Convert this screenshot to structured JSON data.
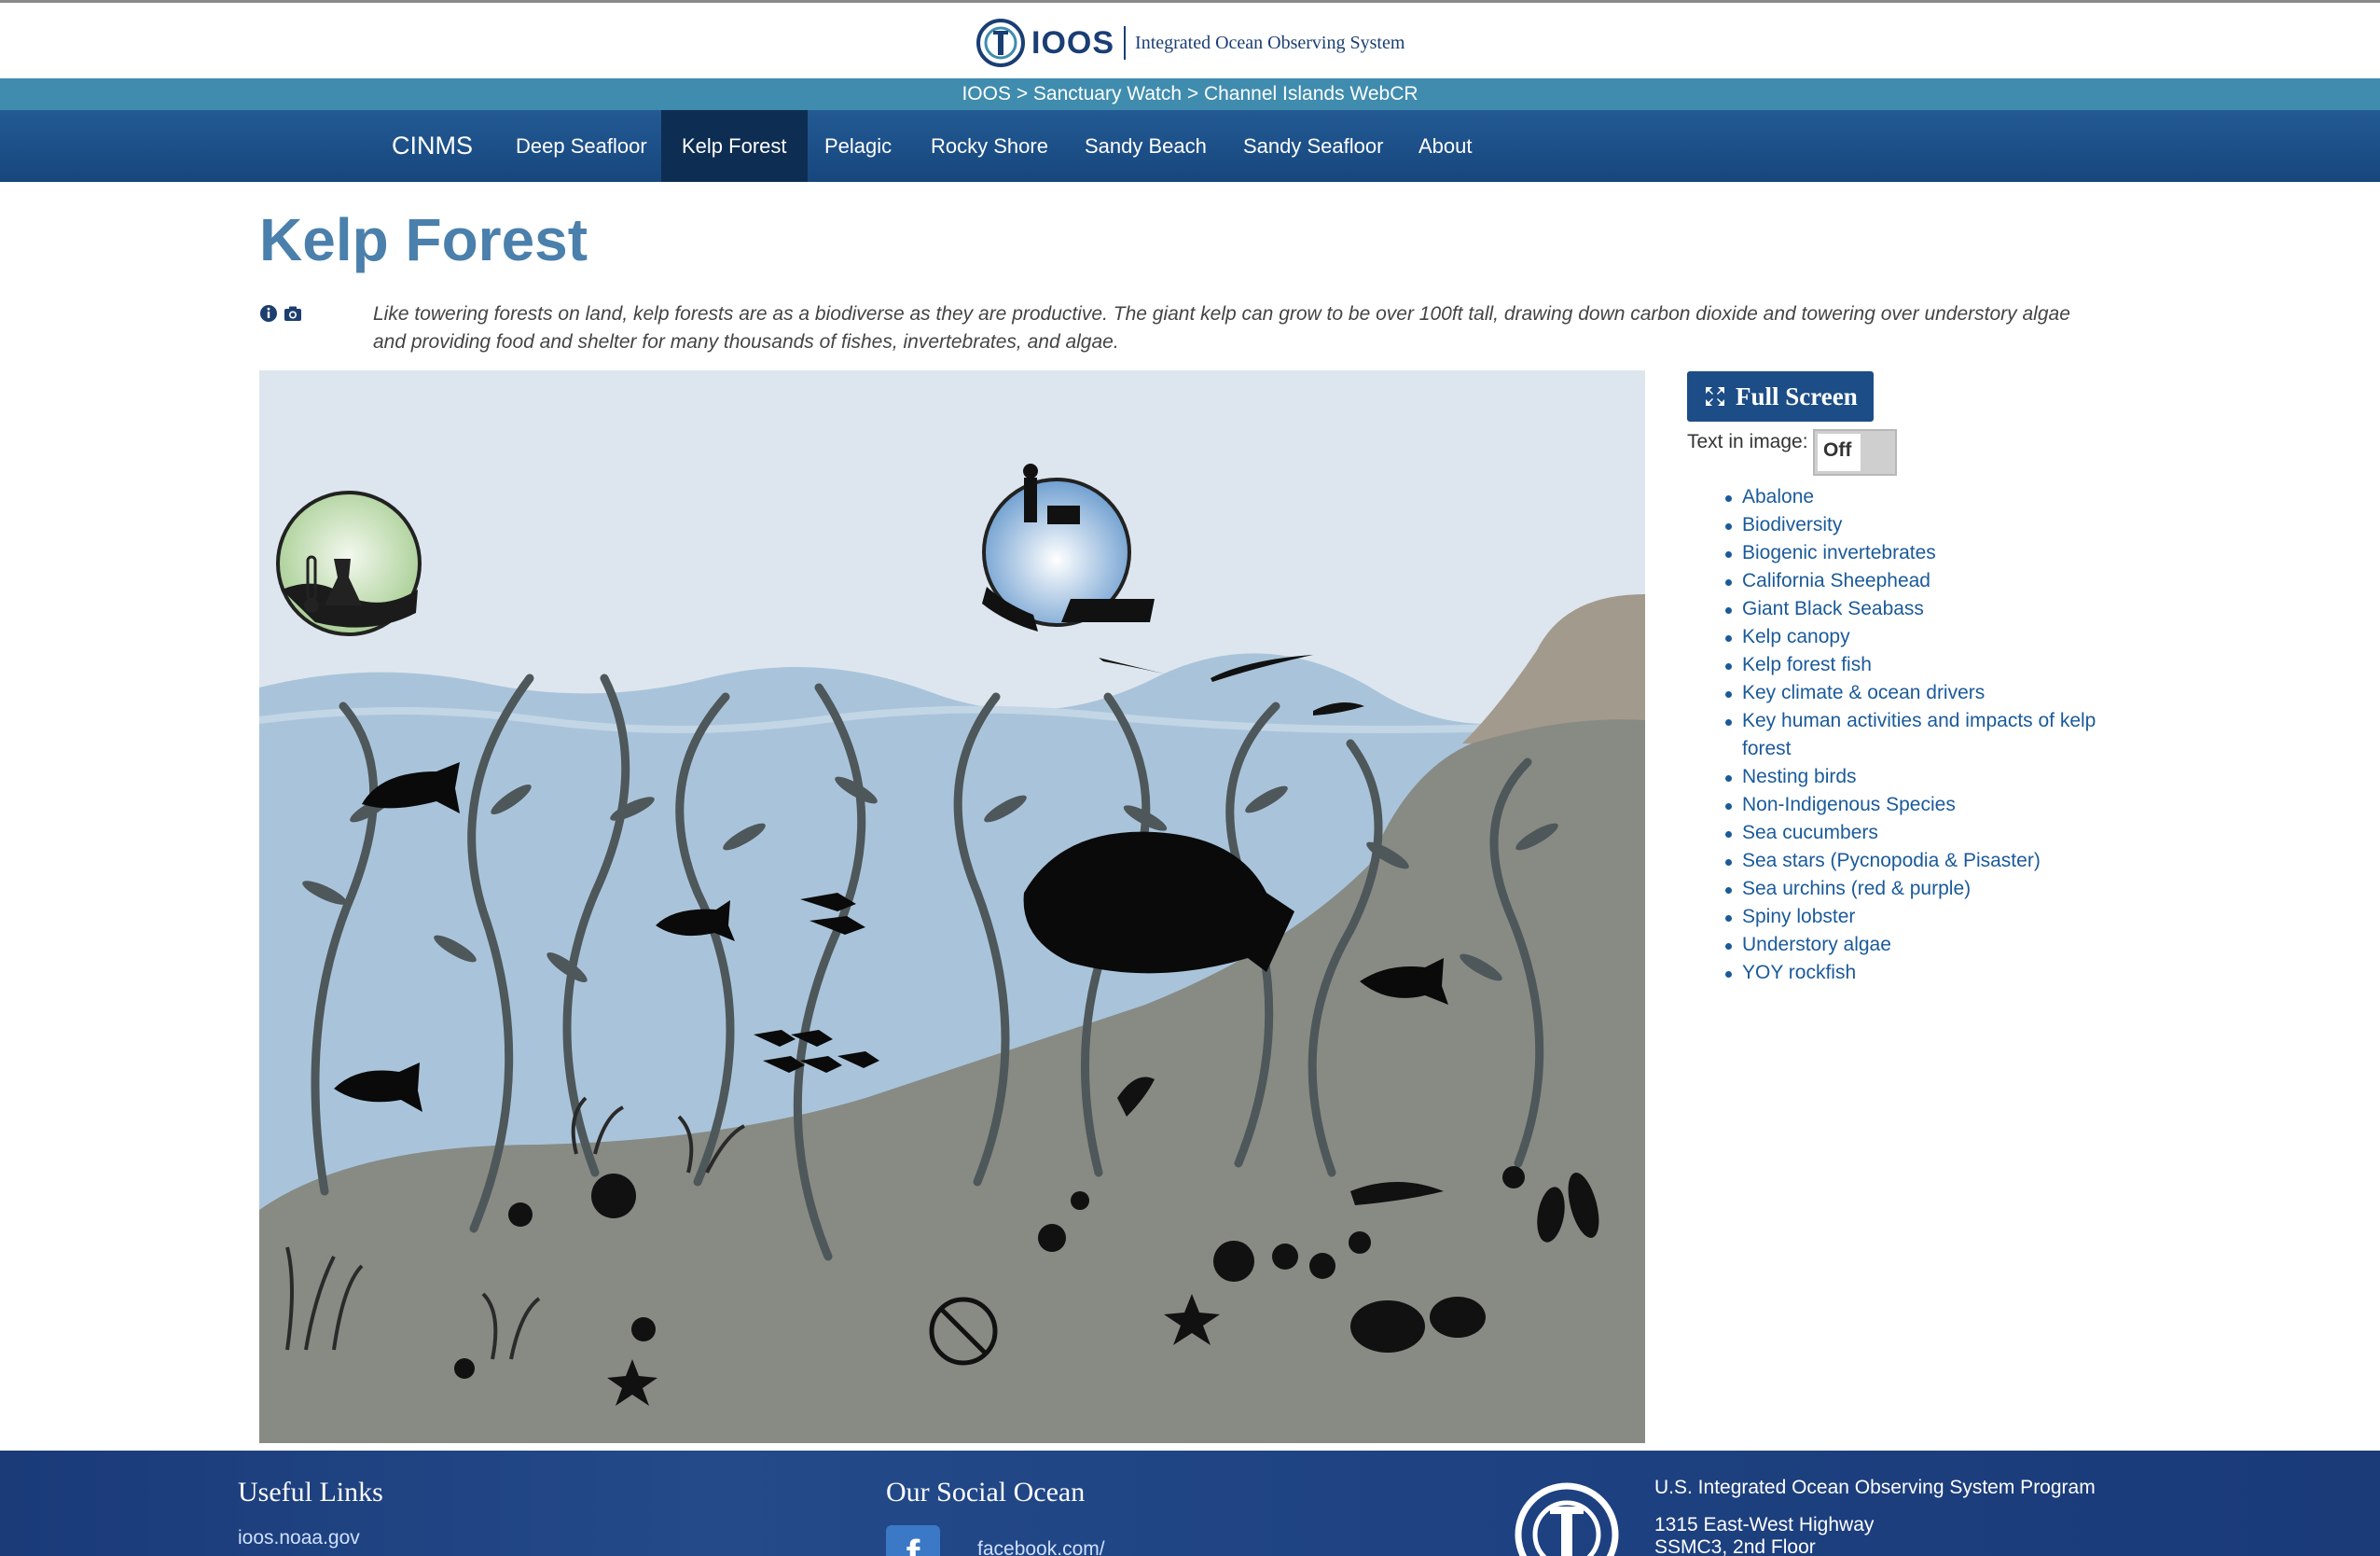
{
  "header": {
    "logo_text": "IOOS",
    "logo_subtitle": "Integrated Ocean Observing System"
  },
  "breadcrumb": "IOOS > Sanctuary Watch > Channel Islands WebCR",
  "nav": {
    "brand": "CINMS",
    "items": [
      "Deep Seafloor",
      "Kelp Forest",
      "Pelagic",
      "Rocky Shore",
      "Sandy Beach",
      "Sandy Seafloor",
      "About"
    ],
    "active": "Kelp Forest"
  },
  "page": {
    "title": "Kelp Forest",
    "description": "Like towering forests on land, kelp forests are as a biodiverse as they are productive. The giant kelp can grow to be over 100ft tall, drawing down carbon dioxide and towering over understory algae and providing food and shelter for many thousands of fishes, invertebrates, and algae."
  },
  "sidebar": {
    "fullscreen_label": "Full Screen",
    "text_in_image_label": "Text in image:",
    "toggle_value": "Off",
    "topics": [
      "Abalone",
      "Biodiversity",
      "Biogenic invertebrates",
      "California Sheephead",
      "Giant Black Seabass",
      "Kelp canopy",
      "Kelp forest fish",
      "Key climate & ocean drivers",
      "Key human activities and impacts of kelp forest",
      "Nesting birds",
      "Non-Indigenous Species",
      "Sea cucumbers",
      "Sea stars (Pycnopodia & Pisaster)",
      "Sea urchins (red & purple)",
      "Spiny lobster",
      "Understory algae",
      "YOY rockfish"
    ]
  },
  "footer": {
    "useful_links_title": "Useful Links",
    "useful_link": "ioos.noaa.gov",
    "social_title": "Our Social Ocean",
    "social_link": "facebook.com/",
    "org_name": "U.S. Integrated Ocean Observing System Program",
    "address_1": "1315 East-West Highway",
    "address_2": "SSMC3, 2nd Floor"
  },
  "icons": [
    "info-icon",
    "camera-icon",
    "expand-icon",
    "facebook-icon",
    "thermometer-icon",
    "flask-icon"
  ],
  "colors": {
    "nav_bg": "#1c4d86",
    "nav_active": "#0d2d52",
    "crumb_bg": "#3f8cae",
    "title": "#4a80ab",
    "link": "#1a5a9a",
    "water": "#a7c3d8",
    "seafloor": "#8a8d86"
  }
}
